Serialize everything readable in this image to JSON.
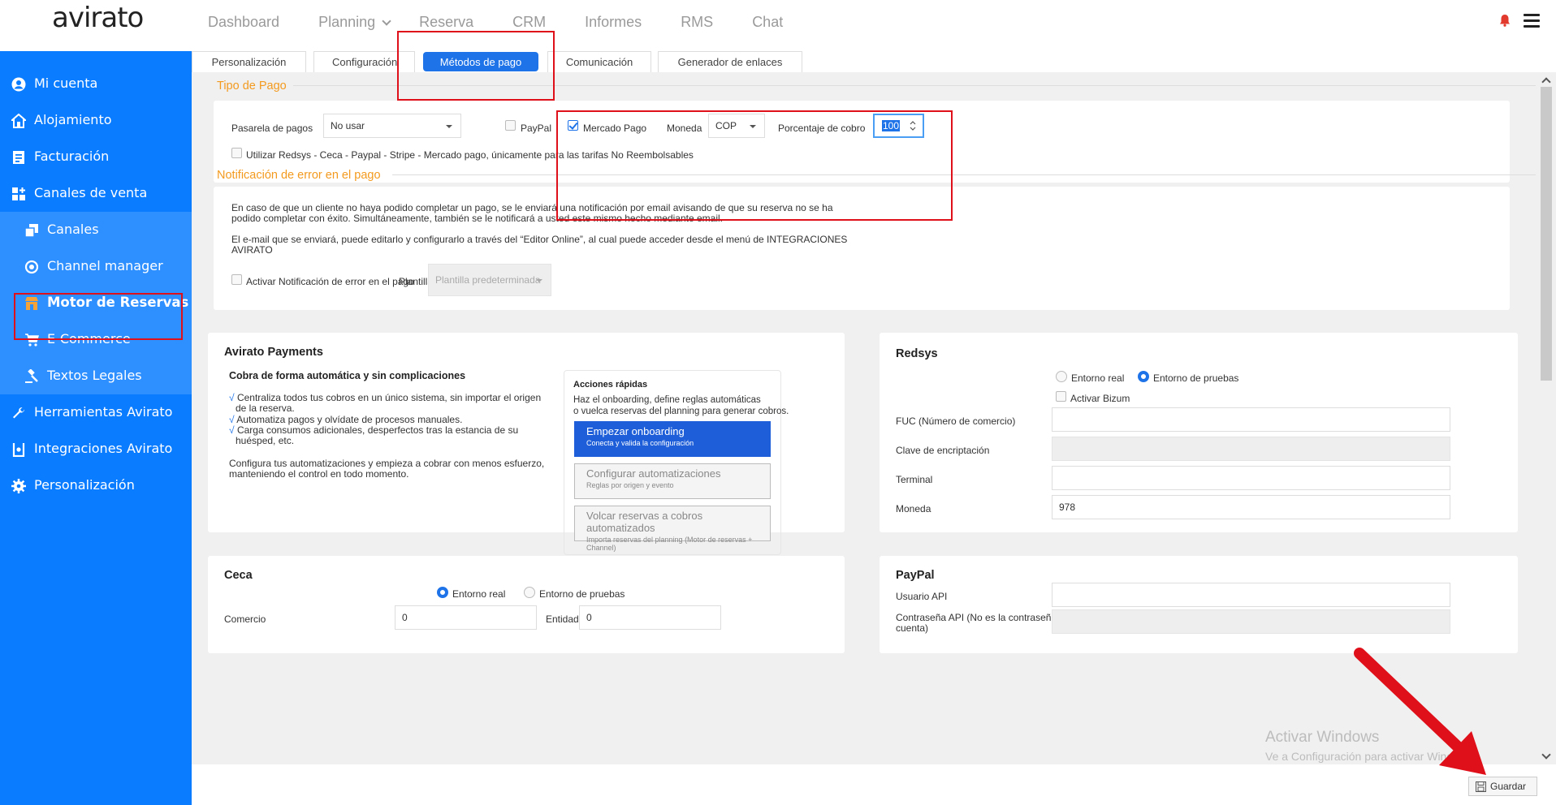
{
  "app": {
    "logo": "avirato"
  },
  "topnav": [
    {
      "label": "Dashboard"
    },
    {
      "label": "Planning"
    },
    {
      "label": "Reserva"
    },
    {
      "label": "CRM"
    },
    {
      "label": "Informes"
    },
    {
      "label": "RMS"
    },
    {
      "label": "Chat"
    }
  ],
  "sidebar": {
    "items": [
      {
        "label": "Mi cuenta",
        "icon": "user-circle-icon"
      },
      {
        "label": "Alojamiento",
        "icon": "house-icon"
      },
      {
        "label": "Facturación",
        "icon": "invoice-icon"
      },
      {
        "label": "Canales de venta",
        "icon": "grid-plus-icon"
      },
      {
        "label": "Canales",
        "icon": "stack-icon"
      },
      {
        "label": "Channel manager",
        "icon": "cycle-icon"
      },
      {
        "label": "Motor de Reservas",
        "icon": "store-icon"
      },
      {
        "label": "E-Commerce",
        "icon": "cart-icon"
      },
      {
        "label": "Textos Legales",
        "icon": "gavel-icon"
      },
      {
        "label": "Herramientas Avirato",
        "icon": "wrench-icon"
      },
      {
        "label": "Integraciones Avirato",
        "icon": "integration-icon"
      },
      {
        "label": "Personalización",
        "icon": "gear-icon"
      }
    ]
  },
  "tabs": [
    {
      "label": "Personalización"
    },
    {
      "label": "Configuración"
    },
    {
      "label": "Métodos de pago",
      "active": true
    },
    {
      "label": "Comunicación"
    },
    {
      "label": "Generador de enlaces"
    }
  ],
  "tipo_pago": {
    "title": "Tipo de Pago",
    "pasarela_label": "Pasarela de pagos",
    "pasarela_value": "No usar",
    "paypal_label": "PayPal",
    "paypal_checked": false,
    "mercado_label": "Mercado Pago",
    "mercado_checked": true,
    "moneda_label": "Moneda",
    "moneda_value": "COP",
    "porcentaje_label": "Porcentaje de cobro",
    "porcentaje_value": "100",
    "redsys_only_label": "Utilizar Redsys - Ceca - Paypal - Stripe - Mercado pago, únicamente para las tarifas No Reembolsables"
  },
  "notificacion": {
    "title": "Notificación de error en el pago",
    "p1_l1": "En caso de que un cliente no haya podido completar un pago, se le enviará una notificación por email avisando de que su reserva no se ha",
    "p1_l2": "podido completar con éxito. Simultáneamente, también se le notificará a usted este mismo hecho mediante email.",
    "p2_l1": "El e-mail que se enviará, puede editarlo y configurarlo a través del “Editor Online”, al cual puede acceder desde el menú de INTEGRACIONES",
    "p2_l2": "AVIRATO",
    "activar_label": "Activar Notificación de error en el pago",
    "plantilla_label": "Plantilla",
    "plantilla_value": "Plantilla predeterminada"
  },
  "avirato_payments": {
    "title": "Avirato Payments",
    "subtitle": "Cobra de forma automática y sin complicaciones",
    "b1_l1": "Centraliza todos tus cobros en un único sistema, sin importar el origen",
    "b1_l2": "de la reserva.",
    "b2": "Automatiza pagos y olvídate de procesos manuales.",
    "b3_l1": "Carga consumos adicionales, desperfectos tras la estancia de su",
    "b3_l2": "huésped, etc.",
    "outro_l1": "Configura tus automatizaciones y empieza a cobrar con menos esfuerzo,",
    "outro_l2": "manteniendo el control en todo momento.",
    "check_mark": "√",
    "quick": {
      "title": "Acciones rápidas",
      "desc_l1": "Haz el onboarding, define reglas automáticas",
      "desc_l2": "o vuelca reservas del planning para generar cobros.",
      "btn1_title": "Empezar onboarding",
      "btn1_sub": "Conecta y valida la configuración",
      "btn2_title": "Configurar automatizaciones",
      "btn2_sub": "Reglas por origen y evento",
      "btn3_title": "Volcar reservas a cobros automatizados",
      "btn3_sub": "Importa reservas del planning (Motor de reservas + Channel)"
    }
  },
  "redsys": {
    "title": "Redsys",
    "entorno_real": "Entorno real",
    "entorno_pruebas": "Entorno de pruebas",
    "bizum": "Activar Bizum",
    "fuc_label": "FUC (Número de comercio)",
    "fuc_value": "",
    "clave_label": "Clave de encriptación",
    "terminal_label": "Terminal",
    "moneda_label": "Moneda",
    "moneda_value": "978"
  },
  "ceca": {
    "title": "Ceca",
    "entorno_real": "Entorno real",
    "entorno_pruebas": "Entorno de pruebas",
    "comercio_label": "Comercio",
    "comercio_value": "0",
    "entidad_label": "Entidad",
    "entidad_value": "0"
  },
  "paypal": {
    "title": "PayPal",
    "usuario_label": "Usuario API",
    "pass_label_l1": "Contraseña API (No es la contraseña de la",
    "pass_label_l2": "cuenta)"
  },
  "windows": {
    "line1": "Activar Windows",
    "line2": "Ve a Configuración para activar Windows."
  },
  "save": {
    "label": "Guardar"
  },
  "colors": {
    "sidebar": "#0a7cff",
    "accent": "#1e73e8",
    "section_title": "#f39a1e",
    "annotation": "#e0101a"
  }
}
